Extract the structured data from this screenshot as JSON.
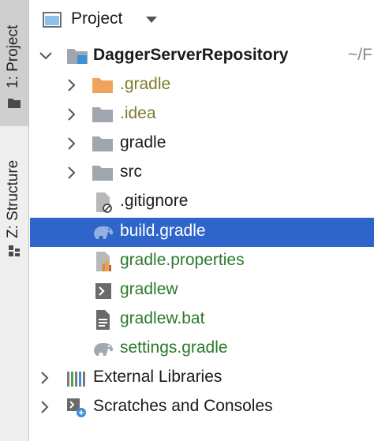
{
  "sidebar": {
    "project_tab": "1: Project",
    "structure_tab": "Z: Structure"
  },
  "header": {
    "title": "Project"
  },
  "tree": {
    "root": {
      "label": "DaggerServerRepository",
      "path": "~/F"
    },
    "items": [
      {
        "label": ".gradle",
        "color": "olive"
      },
      {
        "label": ".idea",
        "color": "olive"
      },
      {
        "label": "gradle",
        "color": "dark"
      },
      {
        "label": "src",
        "color": "dark"
      },
      {
        "label": ".gitignore",
        "color": "dark"
      },
      {
        "label": "build.gradle",
        "color": "white",
        "selected": true
      },
      {
        "label": "gradle.properties",
        "color": "green"
      },
      {
        "label": "gradlew",
        "color": "green"
      },
      {
        "label": "gradlew.bat",
        "color": "green"
      },
      {
        "label": "settings.gradle",
        "color": "green"
      }
    ],
    "external_libraries": "External Libraries",
    "scratches": "Scratches and Consoles"
  },
  "colors": {
    "selection": "#2f65ca",
    "olive_text": "#7b7b2a",
    "green_text": "#2a7a2a",
    "folder": "#a0a6ad",
    "gradle_folder": "#f0a35c"
  }
}
